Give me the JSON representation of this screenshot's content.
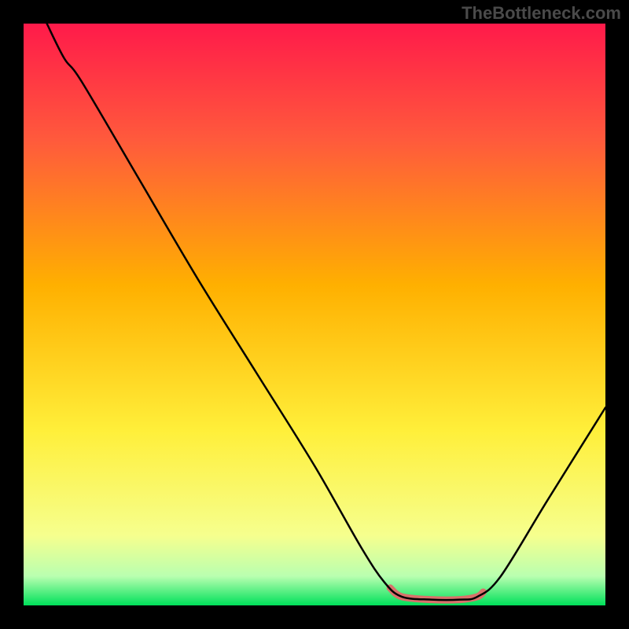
{
  "watermark": "TheBottleneck.com",
  "chart_data": {
    "type": "line",
    "title": "",
    "xlabel": "",
    "ylabel": "",
    "xlim": [
      0,
      100
    ],
    "ylim": [
      0,
      100
    ],
    "gradient_stops": [
      {
        "offset": 0,
        "color": "#ff1a4a"
      },
      {
        "offset": 20,
        "color": "#ff5a3c"
      },
      {
        "offset": 45,
        "color": "#ffb000"
      },
      {
        "offset": 70,
        "color": "#ffef3a"
      },
      {
        "offset": 88,
        "color": "#f6ff8e"
      },
      {
        "offset": 95,
        "color": "#b9ffb0"
      },
      {
        "offset": 100,
        "color": "#00e05a"
      }
    ],
    "series": [
      {
        "name": "bottleneck-curve",
        "color": "#000000",
        "width": 2.5,
        "points": [
          {
            "x": 4,
            "y": 100
          },
          {
            "x": 7,
            "y": 94
          },
          {
            "x": 10,
            "y": 90
          },
          {
            "x": 20,
            "y": 73
          },
          {
            "x": 30,
            "y": 56
          },
          {
            "x": 40,
            "y": 40
          },
          {
            "x": 50,
            "y": 24
          },
          {
            "x": 58,
            "y": 10
          },
          {
            "x": 62,
            "y": 4
          },
          {
            "x": 65,
            "y": 1.5
          },
          {
            "x": 70,
            "y": 1
          },
          {
            "x": 75,
            "y": 1
          },
          {
            "x": 78,
            "y": 1.5
          },
          {
            "x": 82,
            "y": 5
          },
          {
            "x": 90,
            "y": 18
          },
          {
            "x": 100,
            "y": 34
          }
        ]
      }
    ],
    "highlight_segment": {
      "name": "optimal-range",
      "color": "#d9716b",
      "width": 9,
      "x_start": 63,
      "x_end": 79,
      "points": [
        {
          "x": 63,
          "y": 3
        },
        {
          "x": 65,
          "y": 1.5
        },
        {
          "x": 70,
          "y": 1
        },
        {
          "x": 75,
          "y": 1
        },
        {
          "x": 78,
          "y": 1.5
        },
        {
          "x": 79,
          "y": 2.3
        }
      ]
    }
  }
}
